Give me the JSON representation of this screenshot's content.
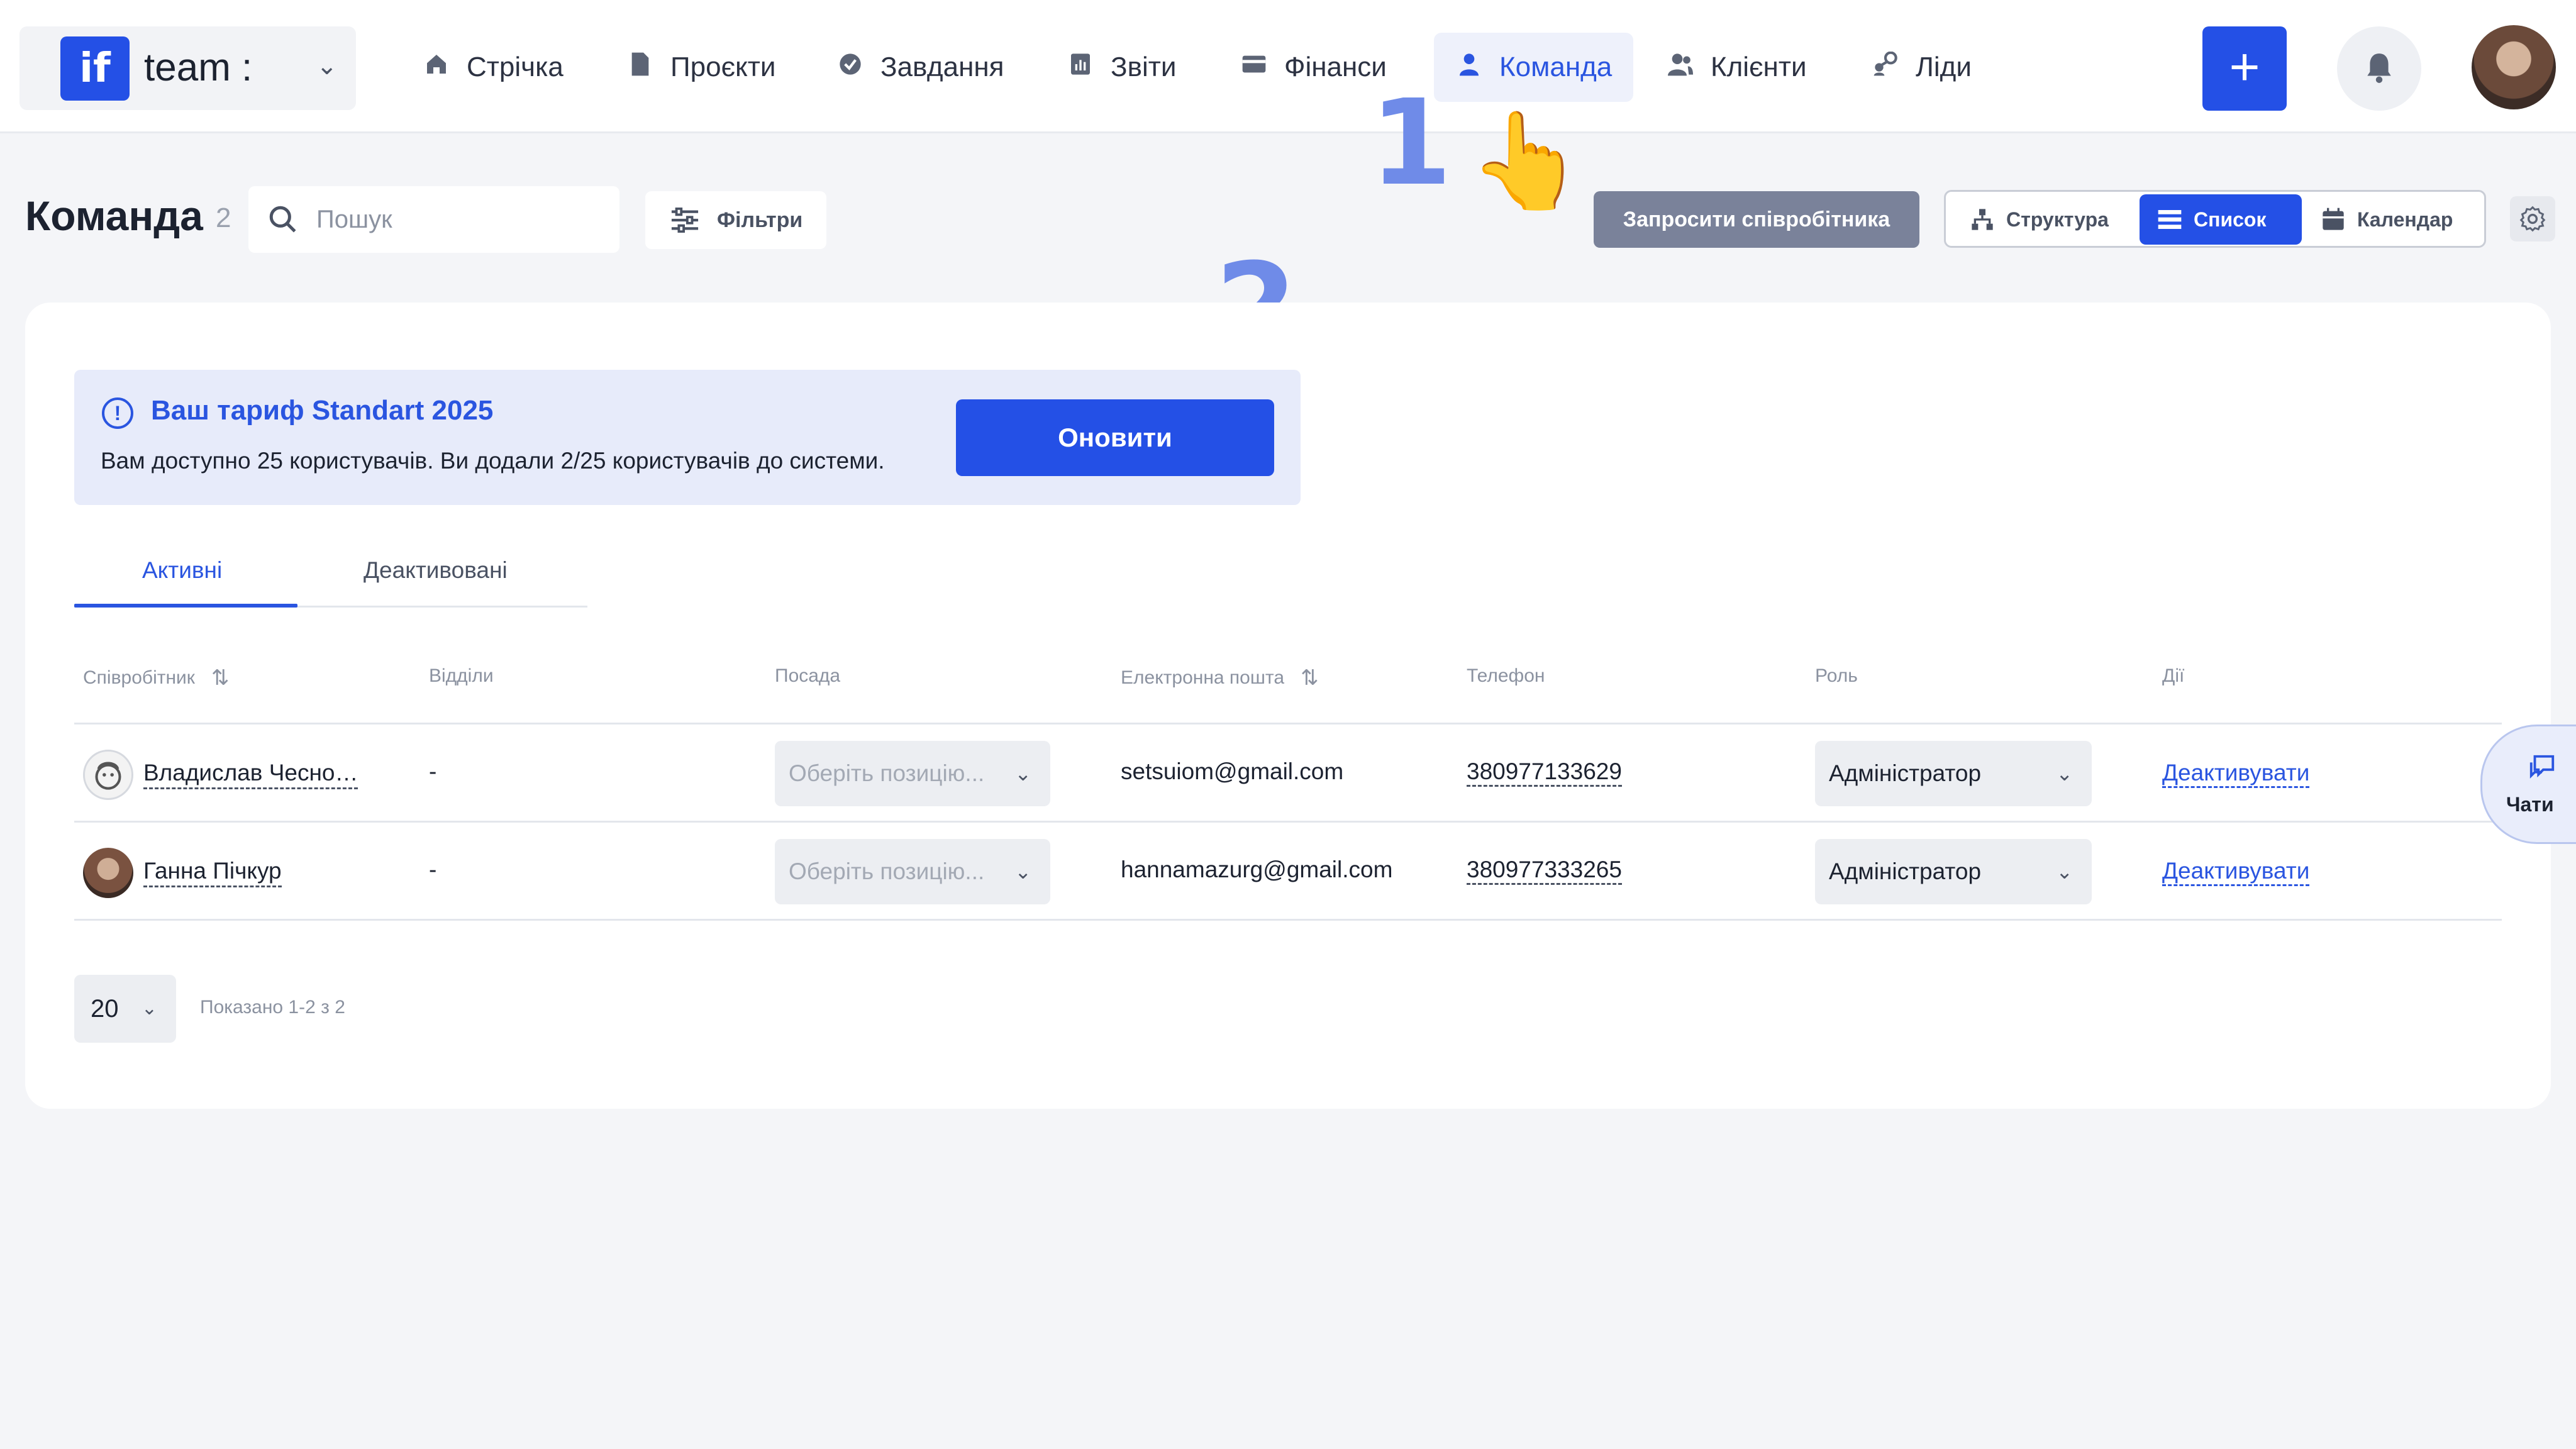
{
  "workspace": {
    "logo_text": "if",
    "name": "team :"
  },
  "nav": {
    "items": [
      {
        "label": "Стрічка",
        "icon": "home-icon"
      },
      {
        "label": "Проєкти",
        "icon": "file-icon"
      },
      {
        "label": "Завдання",
        "icon": "check-circle-icon"
      },
      {
        "label": "Звіти",
        "icon": "report-icon"
      },
      {
        "label": "Фінанси",
        "icon": "wallet-icon"
      },
      {
        "label": "Команда",
        "icon": "user-icon",
        "active": true
      },
      {
        "label": "Клієнти",
        "icon": "users-icon"
      },
      {
        "label": "Ліди",
        "icon": "leads-icon"
      }
    ]
  },
  "header": {
    "add_label": "+"
  },
  "annotations": {
    "step1": "1",
    "step2": "2",
    "pointer_down": "👆",
    "pointer_right": "👉"
  },
  "page": {
    "title": "Команда",
    "count": "2",
    "search_placeholder": "Пошук",
    "filters_label": "Фільтри",
    "invite_label": "Запросити співробітника",
    "views": {
      "structure": "Структура",
      "list": "Список",
      "calendar": "Календар",
      "active": "Список"
    }
  },
  "banner": {
    "info_icon": "!",
    "title": "Ваш тариф Standart 2025",
    "text": "Вам доступно 25 користувачів. Ви додали 2/25 користувачів до системи.",
    "button": "Оновити"
  },
  "tabs": {
    "active": "Активні",
    "deactivated": "Деактивовані"
  },
  "table": {
    "headers": {
      "employee": "Співробітник",
      "departments": "Відділи",
      "position": "Посада",
      "email": "Електронна пошта",
      "phone": "Телефон",
      "role": "Роль",
      "actions": "Дії"
    },
    "sort_icon": "⇅",
    "rows": [
      {
        "name": "Владислав Чесно…",
        "department": "-",
        "position_placeholder": "Оберіть позицію...",
        "email": "setsuiom@gmail.com",
        "phone": "380977133629",
        "role": "Адміністратор",
        "action": "Деактивувати"
      },
      {
        "name": "Ганна Пічкур",
        "department": "-",
        "position_placeholder": "Оберіть позицію...",
        "email": "hannamazurg@gmail.com",
        "phone": "380977333265",
        "role": "Адміністратор",
        "action": "Деактивувати"
      }
    ]
  },
  "pagination": {
    "per_page": "20",
    "shown": "Показано 1-2 з 2"
  },
  "chats": {
    "label": "Чати"
  },
  "colors": {
    "accent": "#2450e6",
    "banner_bg": "#e7ebfa",
    "invite_bg": "#7a829a",
    "page_bg": "#f4f5f8"
  }
}
